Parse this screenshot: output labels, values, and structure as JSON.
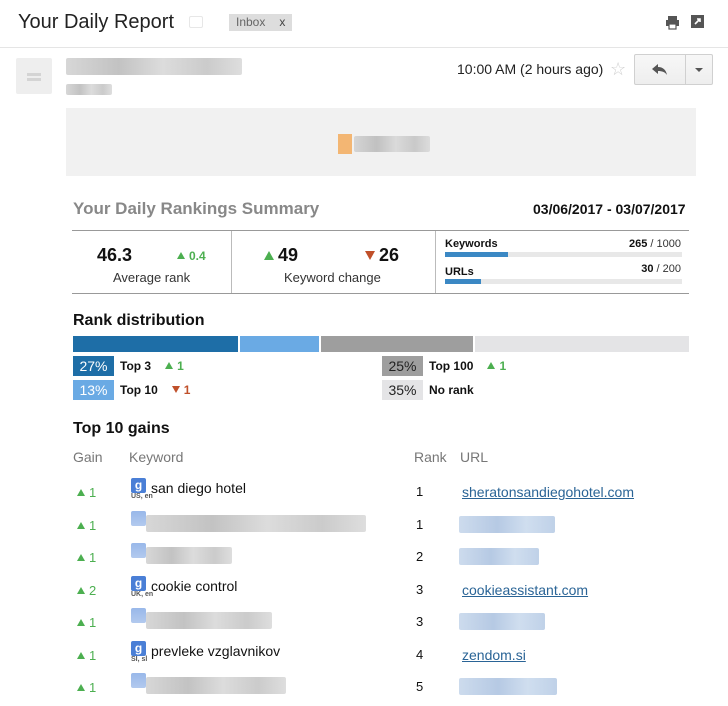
{
  "email": {
    "subject": "Your Daily Report",
    "tag": "Inbox",
    "tag_close": "x",
    "timestamp": "10:00 AM (2 hours ago)"
  },
  "icons": [
    "print-icon",
    "popout-icon",
    "star-icon",
    "reply-icon",
    "chevron-down-icon",
    "google-icon"
  ],
  "summary": {
    "title": "Your Daily Rankings Summary",
    "date_range": "03/06/2017 - 03/07/2017",
    "average_rank": "46.3",
    "average_rank_delta": "0.4",
    "average_rank_label": "Average rank",
    "keyword_up": "49",
    "keyword_down": "26",
    "keyword_change_label": "Keyword change",
    "keywords_label": "Keywords",
    "keywords_used": "265",
    "keywords_total": "/ 1000",
    "keywords_fraction": 0.265,
    "urls_label": "URLs",
    "urls_used": "30",
    "urls_total": "/ 200",
    "urls_fraction": 0.15
  },
  "distribution": {
    "title": "Rank distribution",
    "bar_fractions": [
      0.27,
      0.13,
      0.25,
      0.35
    ],
    "items": [
      {
        "pct": "27%",
        "label": "Top 3",
        "delta": "1",
        "dir": "up",
        "color": "#1e6ea7",
        "text": "#ffffff"
      },
      {
        "pct": "13%",
        "label": "Top 10",
        "delta": "1",
        "dir": "down",
        "color": "#6aaae4",
        "text": "#ffffff"
      },
      {
        "pct": "25%",
        "label": "Top 100",
        "delta": "1",
        "dir": "up",
        "color": "#9e9e9e",
        "text": "#222222"
      },
      {
        "pct": "35%",
        "label": "No rank",
        "delta": "",
        "dir": "",
        "color": "#e4e4e6",
        "text": "#222222"
      }
    ]
  },
  "gains": {
    "title": "Top 10 gains",
    "headers": {
      "gain": "Gain",
      "keyword": "Keyword",
      "rank": "Rank",
      "url": "URL"
    },
    "rows": [
      {
        "gain": "1",
        "keyword": "san diego hotel",
        "loc": "US, en",
        "rank": "1",
        "url": "sheratonsandiegohotel.com"
      },
      {
        "gain": "1",
        "keyword": "",
        "loc": "",
        "rank": "1",
        "url": ""
      },
      {
        "gain": "1",
        "keyword": "",
        "loc": "",
        "rank": "2",
        "url": ""
      },
      {
        "gain": "2",
        "keyword": "cookie control",
        "loc": "UK, en",
        "rank": "3",
        "url": "cookieassistant.com"
      },
      {
        "gain": "1",
        "keyword": "",
        "loc": "",
        "rank": "3",
        "url": ""
      },
      {
        "gain": "1",
        "keyword": "prevleke vzglavnikov",
        "loc": "SI, sl",
        "rank": "4",
        "url": "zendom.si"
      },
      {
        "gain": "1",
        "keyword": "",
        "loc": "",
        "rank": "5",
        "url": ""
      }
    ]
  },
  "colors": {
    "up": "#4caf50",
    "down": "#c0502a",
    "accent": "#3b88c4",
    "link": "#2a6496"
  }
}
